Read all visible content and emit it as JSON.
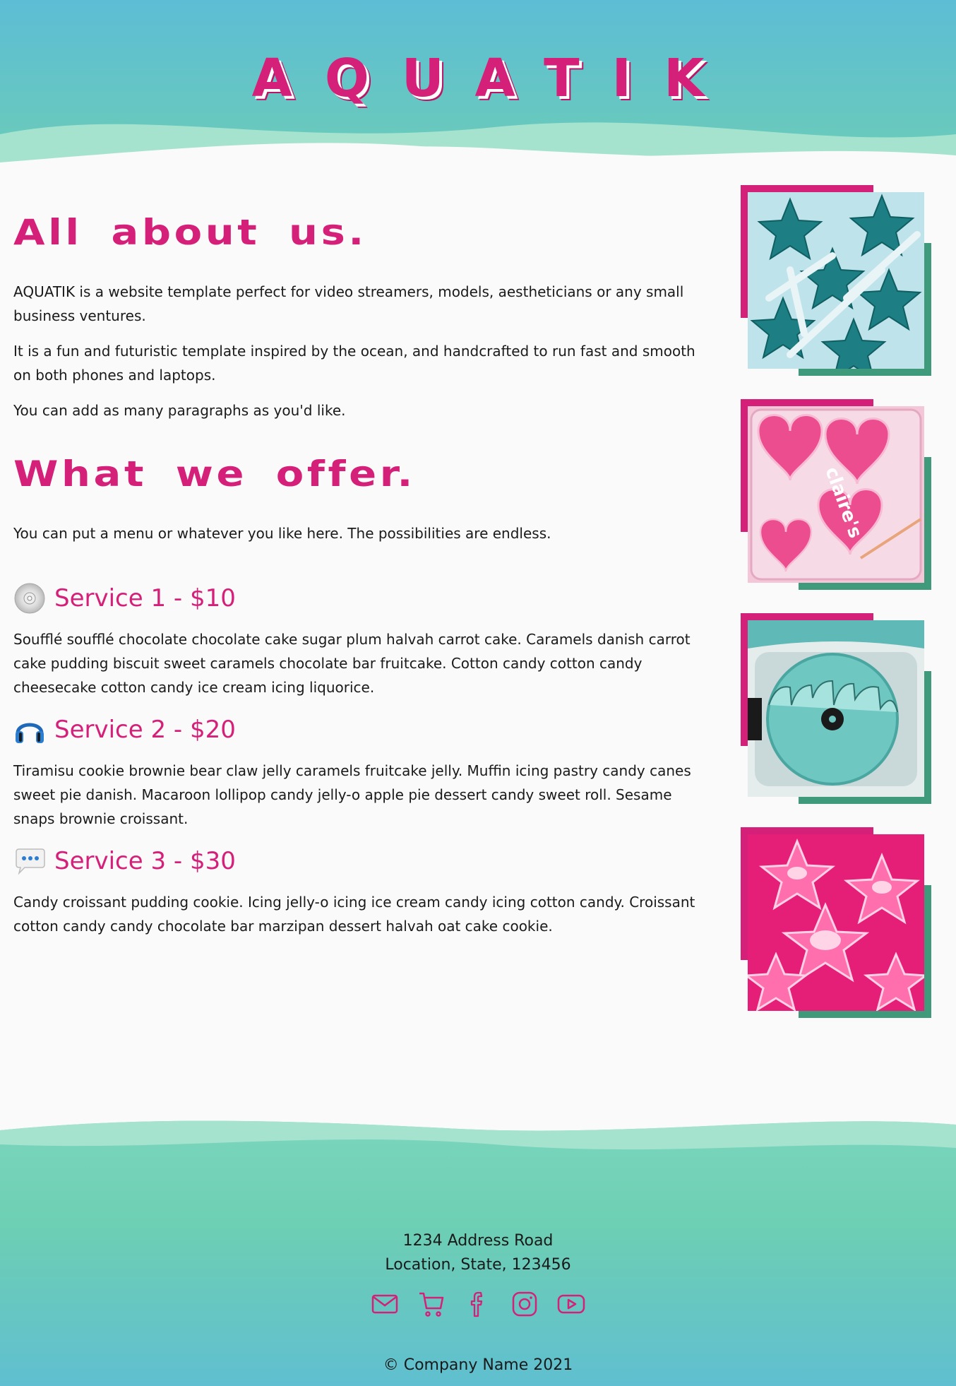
{
  "header": {
    "brand": "AQUATIK"
  },
  "about": {
    "title": "All about us.",
    "paragraphs": [
      "AQUATIK is a website template perfect for video streamers, models, aestheticians or any small business ventures.",
      "It is a fun and futuristic template inspired by the ocean, and handcrafted to run fast and smooth on both phones and laptops.",
      "You can add as many paragraphs as you'd like."
    ]
  },
  "offer": {
    "title": "What we offer.",
    "intro": "You can put a menu or whatever you like here. The possibilities are endless.",
    "services": [
      {
        "icon": "cd-icon",
        "title": "Service 1 - $10",
        "description": "Soufflé soufflé chocolate chocolate cake sugar plum halvah carrot cake. Caramels danish carrot cake pudding biscuit sweet caramels chocolate bar fruitcake. Cotton candy cotton candy cheesecake cotton candy ice cream icing liquorice."
      },
      {
        "icon": "headphones-icon",
        "title": "Service 2 - $20",
        "description": "Tiramisu cookie brownie bear claw jelly caramels fruitcake jelly. Muffin icing pastry candy canes sweet pie danish. Macaroon lollipop candy jelly-o apple pie dessert candy sweet roll. Sesame snaps brownie croissant."
      },
      {
        "icon": "speech-bubble-icon",
        "title": "Service 3 - $30",
        "description": "Candy croissant pudding cookie. Icing jelly-o icing ice cream candy icing cotton candy. Croissant cotton candy candy chocolate bar marzipan dessert halvah oat cake cookie."
      }
    ]
  },
  "gallery": {
    "photos": [
      {
        "name": "teal-star-lollipops-photo"
      },
      {
        "name": "pink-heart-lip-gloss-photo",
        "text": "claire's"
      },
      {
        "name": "teal-cd-player-photo"
      },
      {
        "name": "pink-star-jelly-photo"
      }
    ]
  },
  "footer": {
    "address_line1": "1234 Address Road",
    "address_line2": "Location, State, 123456",
    "social": [
      "mail-icon",
      "cart-icon",
      "facebook-icon",
      "instagram-icon",
      "youtube-icon"
    ],
    "copyright": "© Company Name 2021"
  },
  "colors": {
    "accent": "#d5207a",
    "frame_green": "#3f9a7b",
    "header_top": "#5dbdd5",
    "header_bottom": "#6ccdb6"
  }
}
